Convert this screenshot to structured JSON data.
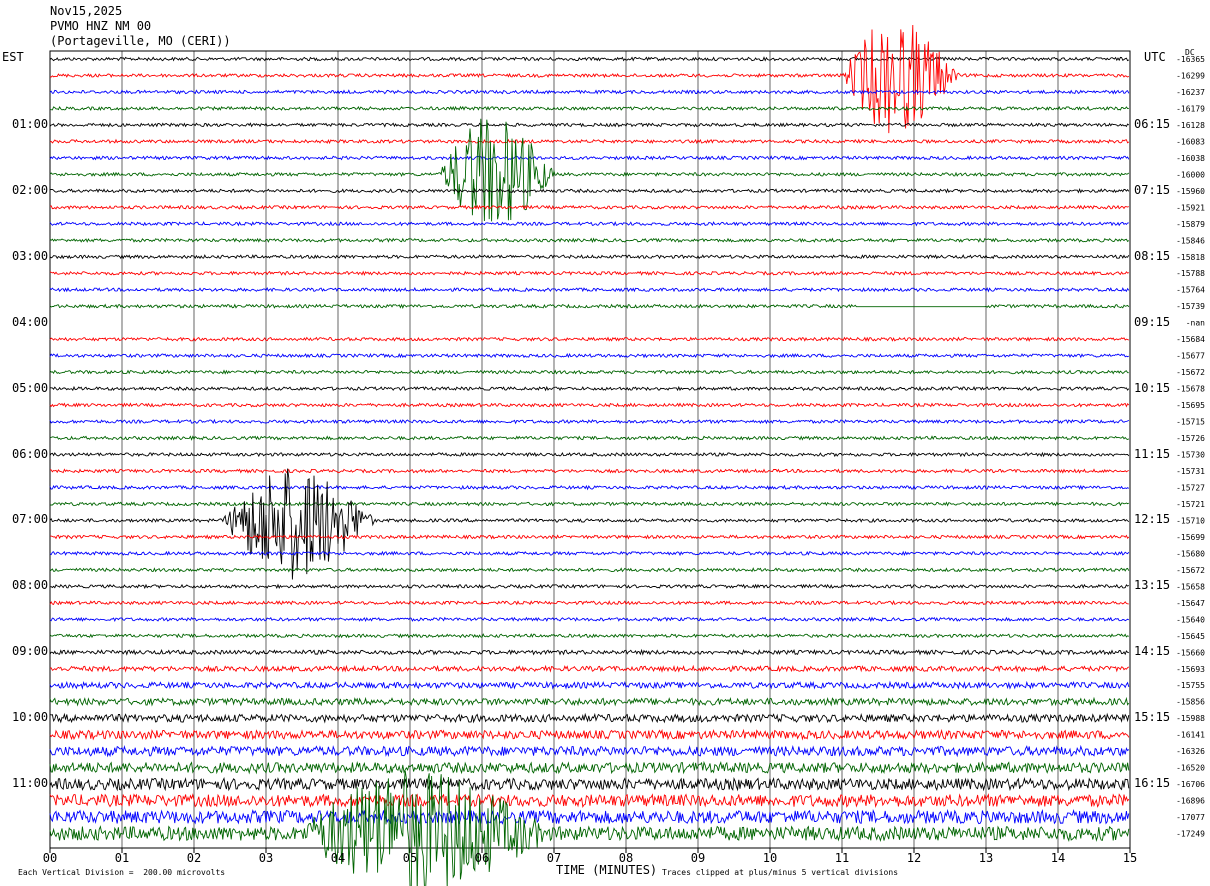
{
  "header": {
    "date": "Nov15,2025",
    "station": "PVMO HNZ NM 00",
    "location": "(Portageville, MO (CERI))"
  },
  "left_timezone": "EST",
  "right_timezone": "UTC",
  "dc_header": "DC",
  "footer": {
    "scale": "Each Vertical Division =  200.00 microvolts",
    "xlabel": "TIME (MINUTES)",
    "clip_note": "Traces clipped at plus/minus 5 vertical divisions"
  },
  "colors": {
    "trace_cycle": [
      "#000000",
      "#ff0000",
      "#0000ff",
      "#006400"
    ],
    "grid": "#000000"
  },
  "chart_data": {
    "type": "line",
    "title": "PVMO HNZ NM 00",
    "xlabel": "TIME (MINUTES)",
    "x_ticks": [
      "00",
      "01",
      "02",
      "03",
      "04",
      "05",
      "06",
      "07",
      "08",
      "09",
      "10",
      "11",
      "12",
      "13",
      "14",
      "15"
    ],
    "xlim": [
      0,
      15
    ],
    "rows_per_hour": 4,
    "row_count": 48,
    "est_labels": [
      "",
      "01:00",
      "02:00",
      "03:00",
      "04:00",
      "05:00",
      "06:00",
      "07:00",
      "08:00",
      "09:00",
      "10:00",
      "11:00"
    ],
    "utc_labels": [
      "",
      "06:15",
      "07:15",
      "08:15",
      "09:15",
      "10:15",
      "11:15",
      "12:15",
      "13:15",
      "14:15",
      "15:15",
      "16:15"
    ],
    "dc_offsets": [
      "-16365",
      "-16299",
      "-16237",
      "-16179",
      "-16128",
      "-16083",
      "-16038",
      "-16000",
      "-15960",
      "-15921",
      "-15879",
      "-15846",
      "-15818",
      "-15788",
      "-15764",
      "-15739",
      "-nan",
      "-15684",
      "-15677",
      "-15672",
      "-15678",
      "-15695",
      "-15715",
      "-15726",
      "-15730",
      "-15731",
      "-15727",
      "-15721",
      "-15710",
      "-15699",
      "-15680",
      "-15672",
      "-15658",
      "-15647",
      "-15640",
      "-15645",
      "-15660",
      "-15693",
      "-15755",
      "-15856",
      "-15988",
      "-16141",
      "-16326",
      "-16520",
      "-16706",
      "-16896",
      "-17077",
      "-17249"
    ],
    "events": [
      {
        "row": 1,
        "start_min": 11.0,
        "end_min": 13.6,
        "amplitude": "clipped"
      },
      {
        "row": 7,
        "start_min": 5.4,
        "end_min": 8.0,
        "amplitude": "clipped"
      },
      {
        "row": 28,
        "start_min": 2.4,
        "end_min": 5.8,
        "amplitude": "clipped"
      },
      {
        "row": 47,
        "start_min": 3.5,
        "end_min": 9.0,
        "amplitude": "clipped"
      }
    ],
    "noise_level_by_row_group": "low in rows 0-35, increasing in rows 36-47",
    "flat_segment": {
      "row": 15,
      "start_min": 11.2,
      "end_min": 13.0
    },
    "grid": true
  }
}
